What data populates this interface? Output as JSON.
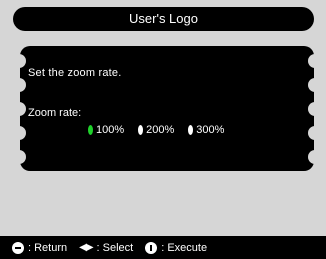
{
  "window": {
    "title": "User's Logo"
  },
  "dialog": {
    "prompt": "Set the zoom rate.",
    "zoom_label": "Zoom rate:",
    "options": [
      "100%",
      "200%",
      "300%"
    ],
    "selected": "100%"
  },
  "footer": {
    "return_label": ": Return",
    "select_label": ": Select",
    "execute_label": ": Execute"
  }
}
